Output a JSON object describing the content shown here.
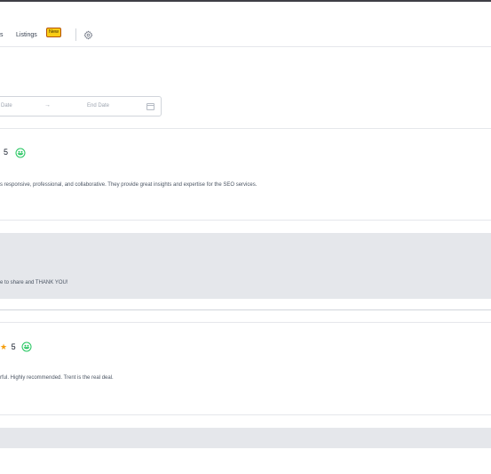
{
  "nav": {
    "cut_item": "s",
    "listings_label": "Listings",
    "new_badge": "New"
  },
  "date_range": {
    "start_placeholder": "Date",
    "arrow": "→",
    "end_placeholder": "End Date"
  },
  "reviews": [
    {
      "rating": "5",
      "text": "s responsive, professional, and collaborative. They provide great insights and expertise for the SEO services.",
      "reply": "e to share and THANK YOU!"
    },
    {
      "star": "★",
      "rating": "5",
      "text": "rful. Highly recommended. Trent is the real deal."
    }
  ],
  "colors": {
    "accent_green": "#22c55e",
    "star": "#f59e0b",
    "badge": "#facc15",
    "reply_bg": "#e5e7eb"
  }
}
